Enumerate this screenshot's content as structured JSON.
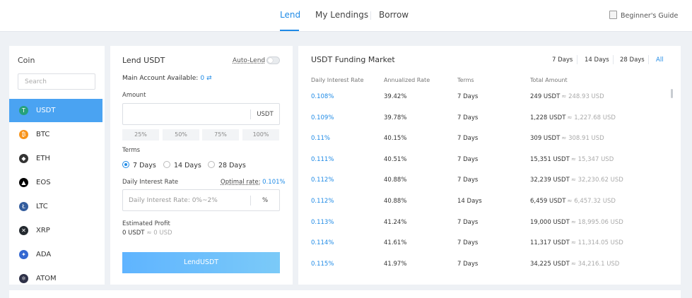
{
  "header": {
    "tabs": [
      {
        "label": "Lend",
        "active": true
      },
      {
        "label": "My Lendings",
        "active": false
      },
      {
        "label": "Borrow",
        "active": false
      }
    ],
    "beginners_guide": "Beginner's Guide"
  },
  "coins": {
    "title": "Coin",
    "search_placeholder": "Search",
    "items": [
      {
        "label": "USDT",
        "icon": "usdt-icon",
        "color": "#26a17b",
        "active": true
      },
      {
        "label": "BTC",
        "icon": "btc-icon",
        "color": "#f7931a",
        "active": false
      },
      {
        "label": "ETH",
        "icon": "eth-icon",
        "color": "#333333",
        "active": false
      },
      {
        "label": "EOS",
        "icon": "eos-icon",
        "color": "#000000",
        "active": false
      },
      {
        "label": "LTC",
        "icon": "ltc-icon",
        "color": "#345d9d",
        "active": false
      },
      {
        "label": "XRP",
        "icon": "xrp-icon",
        "color": "#23292f",
        "active": false
      },
      {
        "label": "ADA",
        "icon": "ada-icon",
        "color": "#3468d1",
        "active": false
      },
      {
        "label": "ATOM",
        "icon": "atom-icon",
        "color": "#2e3148",
        "active": false
      }
    ]
  },
  "lend": {
    "title": "Lend USDT",
    "auto_lend_label": "Auto-Lend",
    "auto_lend_on": false,
    "main_account_label": "Main Account Available:",
    "main_account_value": "0",
    "swap_symbol": "⇄",
    "amount_label": "Amount",
    "amount_unit": "USDT",
    "percent_options": [
      "25%",
      "50%",
      "75%",
      "100%"
    ],
    "terms_label": "Terms",
    "terms_options": [
      {
        "label": "7 Days",
        "selected": true
      },
      {
        "label": "14 Days",
        "selected": false
      },
      {
        "label": "28 Days",
        "selected": false
      }
    ],
    "daily_rate_label": "Daily Interest Rate",
    "optimal_rate_label": "Optimal rate:",
    "optimal_rate_value": "0.101%",
    "rate_placeholder": "Daily Interest Rate: 0%~2%",
    "rate_unit": "%",
    "estimated_profit_label": "Estimated Profit",
    "estimated_profit_value": "0 USDT",
    "estimated_profit_usd": "≈ 0 USD",
    "lend_button": "LendUSDT"
  },
  "market": {
    "title": "USDT Funding Market",
    "periods": [
      {
        "label": "7 Days",
        "active": false
      },
      {
        "label": "14 Days",
        "active": false
      },
      {
        "label": "28 Days",
        "active": false
      },
      {
        "label": "All",
        "active": true
      }
    ],
    "columns": [
      "Daily Interest Rate",
      "Annualized Rate",
      "Terms",
      "Total Amount"
    ],
    "rows": [
      {
        "rate": "0.108%",
        "annual": "39.42%",
        "terms": "7 Days",
        "amount": "249 USDT",
        "usd": "≈ 248.93 USD"
      },
      {
        "rate": "0.109%",
        "annual": "39.78%",
        "terms": "7 Days",
        "amount": "1,228 USDT",
        "usd": "≈ 1,227.68 USD"
      },
      {
        "rate": "0.11%",
        "annual": "40.15%",
        "terms": "7 Days",
        "amount": "309 USDT",
        "usd": "≈ 308.91 USD"
      },
      {
        "rate": "0.111%",
        "annual": "40.51%",
        "terms": "7 Days",
        "amount": "15,351 USDT",
        "usd": "≈ 15,347 USD"
      },
      {
        "rate": "0.112%",
        "annual": "40.88%",
        "terms": "7 Days",
        "amount": "32,239 USDT",
        "usd": "≈ 32,230.62 USD"
      },
      {
        "rate": "0.112%",
        "annual": "40.88%",
        "terms": "14 Days",
        "amount": "6,459 USDT",
        "usd": "≈ 6,457.32 USD"
      },
      {
        "rate": "0.113%",
        "annual": "41.24%",
        "terms": "7 Days",
        "amount": "19,000 USDT",
        "usd": "≈ 18,995.06 USD"
      },
      {
        "rate": "0.114%",
        "annual": "41.61%",
        "terms": "7 Days",
        "amount": "11,317 USDT",
        "usd": "≈ 11,314.05 USD"
      },
      {
        "rate": "0.115%",
        "annual": "41.97%",
        "terms": "7 Days",
        "amount": "34,225 USDT",
        "usd": "≈ 34,216.1 USD"
      }
    ]
  },
  "colors": {
    "accent": "#1e8ae6",
    "active_coin_bg": "#4aa3f2",
    "page_bg": "#eef1f5"
  }
}
